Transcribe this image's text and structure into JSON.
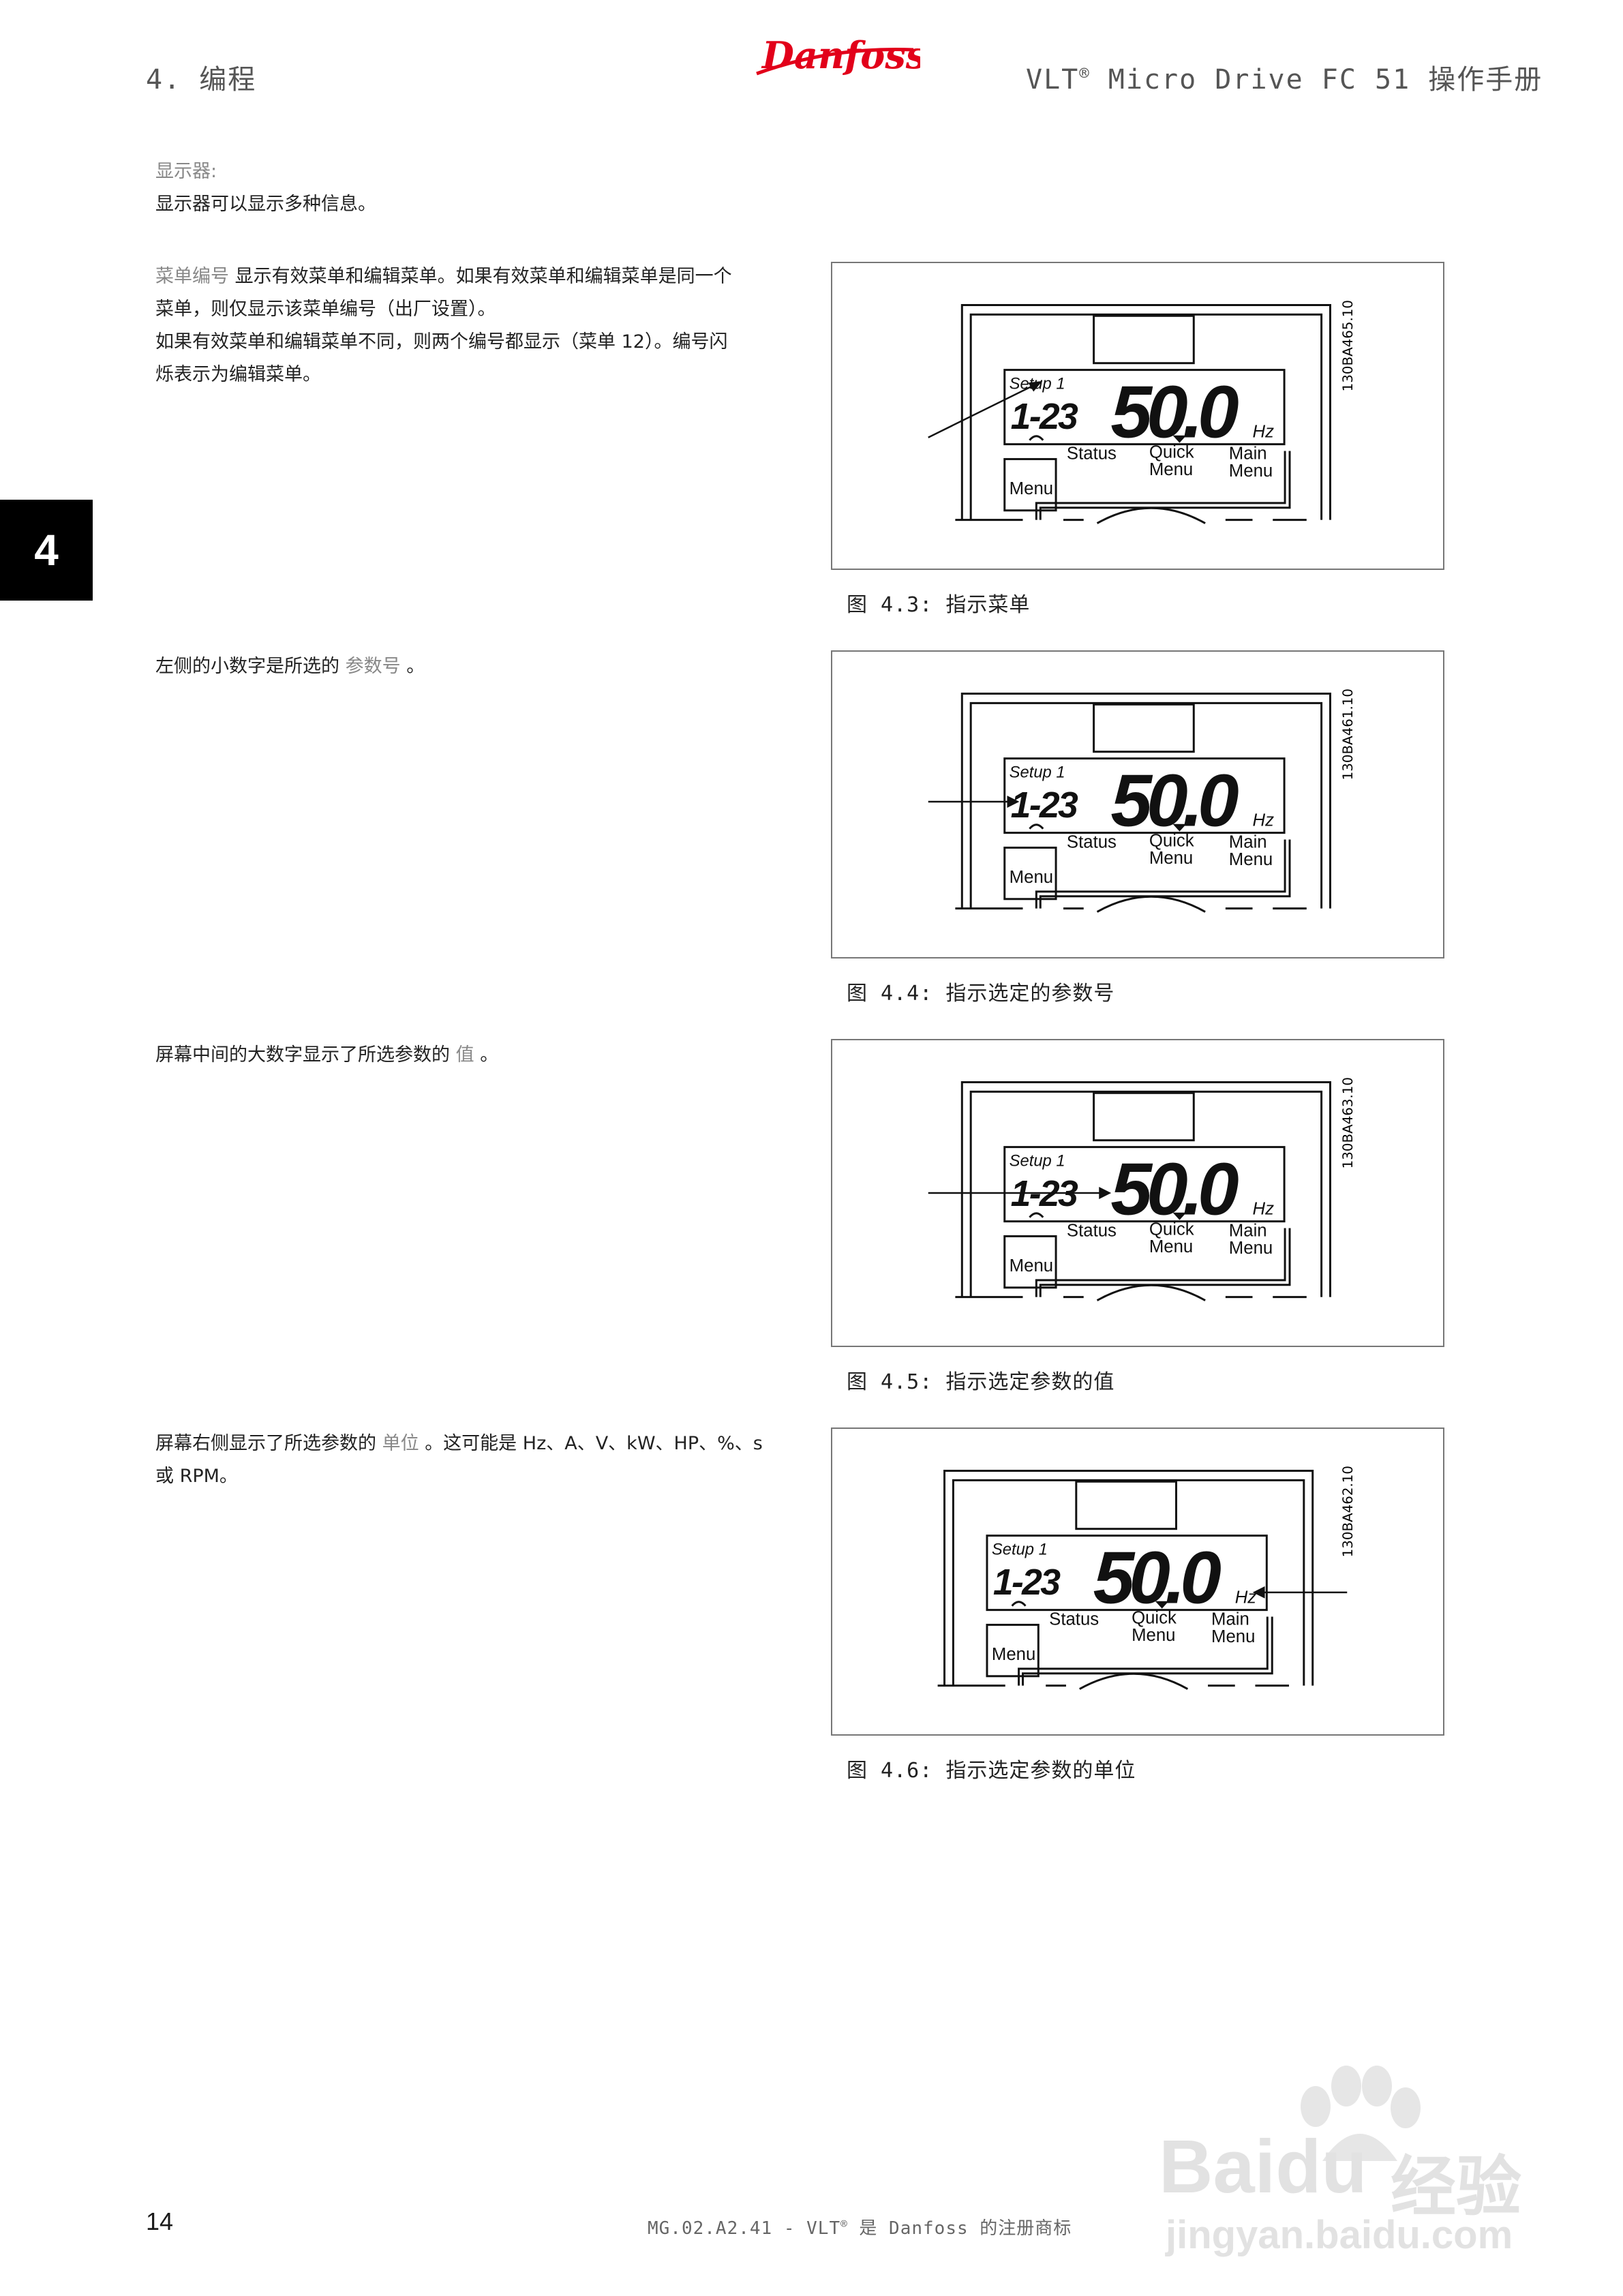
{
  "header": {
    "chapter": "4. 编程",
    "logo_text": "Danfoss",
    "product_prefix": "VLT",
    "registered": "®",
    "product_suffix": "Micro Drive FC 51 操作手册"
  },
  "side_tab": "4",
  "intro": {
    "title": "显示器:",
    "line": "显示器可以显示多种信息。"
  },
  "sections": [
    {
      "term": "菜单编号",
      "text_1": "显示有效菜单和编辑菜单。如果有效菜单和编辑菜单是同一个",
      "text_2": "菜单，则仅显示该菜单编号（出厂设置）。",
      "text_3": "如果有效菜单和编辑菜单不同，则两个编号都显示（菜单 12）。编号闪",
      "text_4": "烁表示为编辑菜单。",
      "caption": "图 4.3: 指示菜单"
    },
    {
      "prefix": "左侧的小数字是所选的",
      "term": "参数号",
      "suffix": "。",
      "caption": "图 4.4: 指示选定的参数号"
    },
    {
      "prefix": "屏幕中间的大数字显示了所选参数的",
      "term": "值",
      "suffix": "。",
      "caption": "图 4.5: 指示选定参数的值"
    },
    {
      "prefix": "屏幕右侧显示了所选参数的",
      "term": "单位",
      "suffix": "。这可能是 Hz、A、V、kW、HP、%、s",
      "line_2": "或 RPM。",
      "caption": "图 4.6: 指示选定参数的单位"
    }
  ],
  "lcp": {
    "setup": "Setup 1",
    "param": "1-23",
    "value": "50.0",
    "unit": "Hz",
    "status": "Status",
    "quick_1": "Quick",
    "quick_2": "Menu",
    "main_1": "Main",
    "main_2": "Menu",
    "menu": "Menu"
  },
  "figure_codes": [
    "130BA465.10",
    "130BA461.10",
    "130BA463.10",
    "130BA462.10"
  ],
  "footer": {
    "page": "14",
    "doc_prefix": "MG.02.A2.41 - VLT",
    "registered": "®",
    "doc_suffix": "是 Danfoss 的注册商标"
  },
  "watermark": {
    "brand": "Bai",
    "brand_2": "du",
    "brand_cn": "经验",
    "url": "jingyan.baidu.com"
  }
}
